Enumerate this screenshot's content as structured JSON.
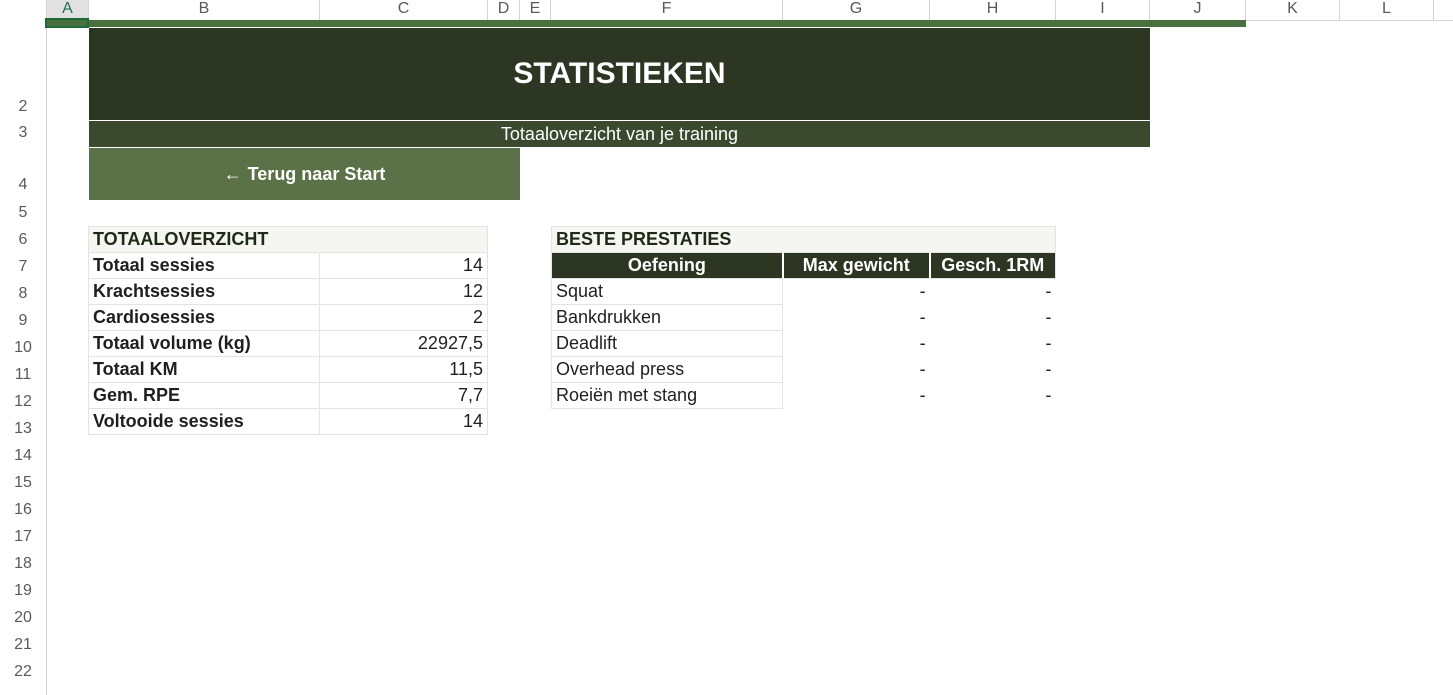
{
  "columns": [
    "A",
    "B",
    "C",
    "D",
    "E",
    "F",
    "G",
    "H",
    "I",
    "J",
    "K",
    "L"
  ],
  "rows": [
    "2",
    "3",
    "4",
    "5",
    "6",
    "7",
    "8",
    "9",
    "10",
    "11",
    "12",
    "13",
    "14",
    "15",
    "16",
    "17",
    "18",
    "19",
    "20",
    "21",
    "22"
  ],
  "banner": {
    "title": "STATISTIEKEN",
    "subtitle": "Totaaloverzicht van je training"
  },
  "back_button": {
    "arrow": "←",
    "label": "Terug naar Start"
  },
  "overview": {
    "title": "TOTAALOVERZICHT",
    "items": [
      {
        "label": "Totaal sessies",
        "value": "14"
      },
      {
        "label": "Krachtsessies",
        "value": "12"
      },
      {
        "label": "Cardiosessies",
        "value": "2"
      },
      {
        "label": "Totaal volume (kg)",
        "value": "22927,5"
      },
      {
        "label": "Totaal KM",
        "value": "11,5"
      },
      {
        "label": "Gem. RPE",
        "value": "7,7"
      },
      {
        "label": "Voltooide sessies",
        "value": "14"
      }
    ]
  },
  "best": {
    "title": "BESTE PRESTATIES",
    "headers": [
      "Oefening",
      "Max gewicht",
      "Gesch. 1RM"
    ],
    "rows": [
      {
        "exercise": "Squat",
        "max": "-",
        "rm": "-"
      },
      {
        "exercise": "Bankdrukken",
        "max": "-",
        "rm": "-"
      },
      {
        "exercise": "Deadlift",
        "max": "-",
        "rm": "-"
      },
      {
        "exercise": "Overhead press",
        "max": "-",
        "rm": "-"
      },
      {
        "exercise": "Roeiën met stang",
        "max": "-",
        "rm": "-"
      }
    ]
  },
  "colors": {
    "banner_dark": "#2c3622",
    "banner_sub": "#3b4a2e",
    "button": "#5b7147",
    "accent_line": "#4b7040"
  }
}
